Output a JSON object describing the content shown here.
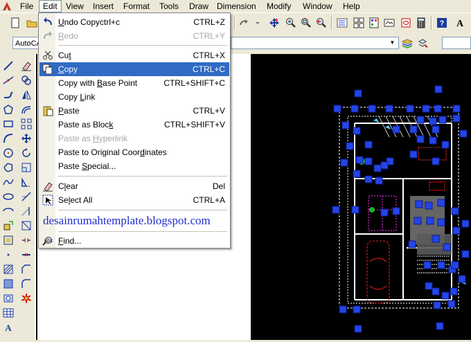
{
  "menubar": {
    "items": [
      "File",
      "Edit",
      "View",
      "Insert",
      "Format",
      "Tools",
      "Draw",
      "Dimension",
      "Modify",
      "Window",
      "Help"
    ]
  },
  "toolbar": {
    "workspace_combo": "AutoCA"
  },
  "edit_menu": {
    "undo": {
      "label": "Undo Copyctrl+c",
      "shortcut": "CTRL+Z"
    },
    "redo": {
      "label": "Redo",
      "shortcut": "CTRL+Y"
    },
    "cut": {
      "label": "Cut",
      "shortcut": "CTRL+X"
    },
    "copy": {
      "label": "Copy",
      "shortcut": "CTRL+C"
    },
    "copy_base": {
      "label": "Copy with Base Point",
      "shortcut": "CTRL+SHIFT+C"
    },
    "copy_link": {
      "label": "Copy Link"
    },
    "paste": {
      "label": "Paste",
      "shortcut": "CTRL+V"
    },
    "paste_block": {
      "label": "Paste as Block",
      "shortcut": "CTRL+SHIFT+V"
    },
    "paste_hyperlink": {
      "label": "Paste as Hyperlink"
    },
    "paste_original": {
      "label": "Paste to Original Coordinates"
    },
    "paste_special": {
      "label": "Paste Special..."
    },
    "clear": {
      "label": "Clear",
      "shortcut": "Del"
    },
    "select_all": {
      "label": "Select All",
      "shortcut": "CTRL+A"
    },
    "find": {
      "label": "Find..."
    }
  },
  "watermark": "desainrumahtemplate.blogspot.com",
  "colors": {
    "menu_highlight": "#316ac5",
    "canvas_bg": "#000000",
    "grip_blue": "#2445e6",
    "watermark": "#1f2ecf"
  }
}
